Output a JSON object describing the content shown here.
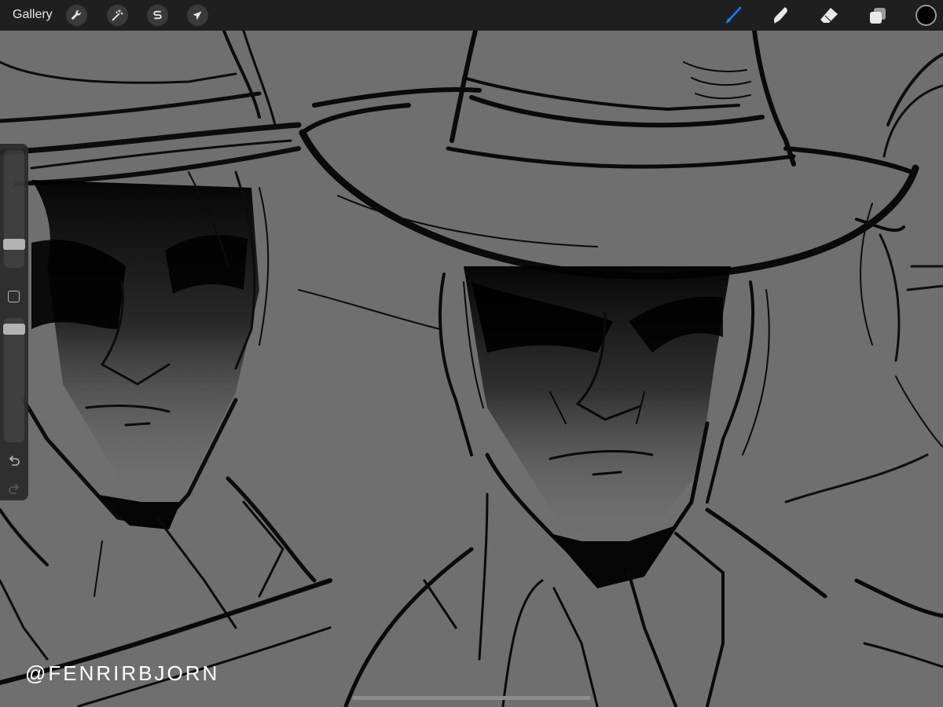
{
  "topbar": {
    "gallery_label": "Gallery",
    "left_tools": [
      {
        "icon": "wrench-icon",
        "name": "actions"
      },
      {
        "icon": "magic-wand-icon",
        "name": "adjustments"
      },
      {
        "icon": "selection-s-icon",
        "name": "selection"
      },
      {
        "icon": "arrow-cursor-icon",
        "name": "transform"
      }
    ],
    "right_tools": [
      {
        "icon": "brush-icon",
        "name": "brush",
        "active": true
      },
      {
        "icon": "smudge-icon",
        "name": "smudge",
        "active": false
      },
      {
        "icon": "eraser-icon",
        "name": "eraser",
        "active": false
      },
      {
        "icon": "layers-icon",
        "name": "layers",
        "active": false
      }
    ],
    "current_color": "#000000",
    "accent_color": "#1e7bff"
  },
  "sidebar": {
    "brush_size_level": 0.17,
    "opacity_level": 0.95,
    "undo_icon": "undo-icon",
    "redo_icon": "redo-icon"
  },
  "canvas": {
    "background": "#6f6f6f",
    "watermark": "@FENRIRBJORN"
  }
}
